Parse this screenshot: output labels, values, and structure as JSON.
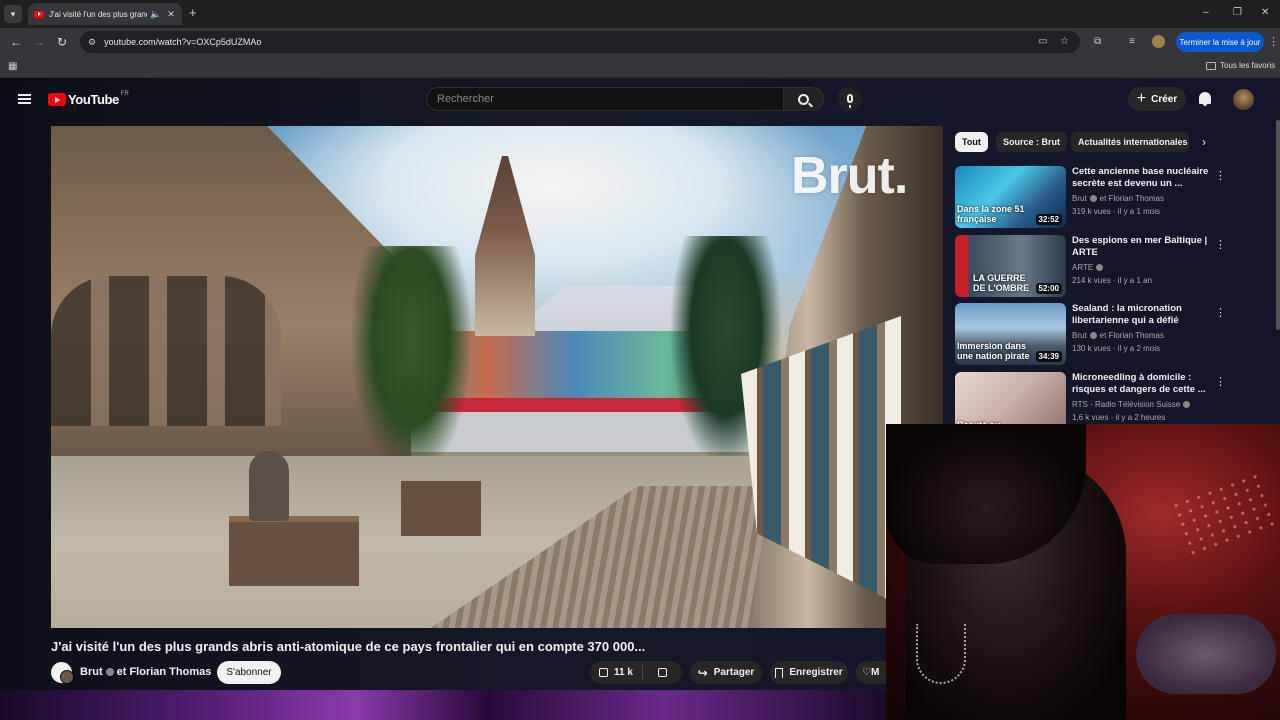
{
  "browser": {
    "tab_title": "J'ai visité l'un des plus grands",
    "tab_list_icon": "chevron-down-icon",
    "new_tab_glyph": "+",
    "window_controls": [
      "–",
      "❐",
      "✕"
    ],
    "url": "youtube.com/watch?v=OXCp5dUZMAo",
    "update_button": "Terminer la mise à jour",
    "bookmarks_all": "Tous les favoris"
  },
  "header": {
    "logo_text": "YouTube",
    "logo_country": "FR",
    "search_placeholder": "Rechercher",
    "create_label": "Créer"
  },
  "video": {
    "overlay_brand": "Brut.",
    "title": "J'ai visité l'un des plus grands abris anti-atomique de ce pays frontalier qui en compte 370 000...",
    "channel": "Brut",
    "channel_suffix": "et Florian Thomas",
    "subscribe_label": "S'abonner",
    "likes": "11 k",
    "share_label": "Partager",
    "save_label": "Enregistrer",
    "more_label": "M"
  },
  "sidebar": {
    "chips": [
      "Tout",
      "Source : Brut",
      "Actualités internationales"
    ],
    "recommendations": [
      {
        "title": "Cette ancienne base nucléaire secrète est devenu un ...",
        "channel": "Brut",
        "channel_suffix": "et Florian Thomas",
        "meta": "319 k vues · il y a 1 mois",
        "duration": "32:52",
        "overlay": "Dans la zone 51 française"
      },
      {
        "title": "Des espions en mer Baltique | ARTE",
        "channel": "ARTE",
        "channel_suffix": "",
        "meta": "214 k vues · il y a 1 an",
        "duration": "52:00",
        "overlay": "LA GUERRE DE L'OMBRE"
      },
      {
        "title": "Sealand : la micronation libertarienne qui a défié l'armé...",
        "channel": "Brut",
        "channel_suffix": "et Florian Thomas",
        "meta": "130 k vues · il y a 2 mois",
        "duration": "34:39",
        "overlay": "Immersion dans une nation pirate"
      },
      {
        "title": "Microneedling à domicile : risques et dangers de cette ...",
        "channel": "RTS - Radio Télévision Suisse",
        "channel_suffix": "",
        "meta": "1,6 k vues · il y a 2 heures",
        "duration": "",
        "overlay": "Beauté ou"
      }
    ]
  }
}
